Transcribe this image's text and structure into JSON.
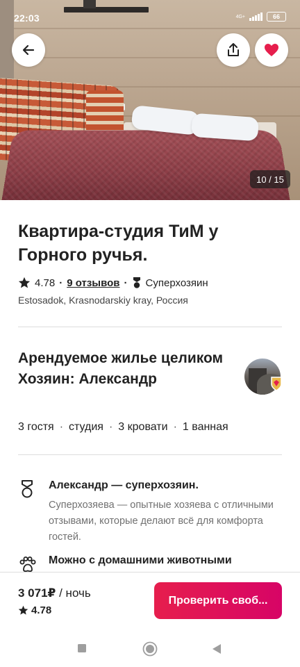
{
  "status_bar": {
    "time": "22:03",
    "network": "4G+",
    "battery": "66"
  },
  "photo": {
    "counter": "10 / 15"
  },
  "listing": {
    "title": "Квартира-студия ТиМ у Горного ручья.",
    "rating": "4.78",
    "reviews": "9 отзывов",
    "host_badge": "Суперхозяин",
    "location": "Estosadok, Krasnodarskiy kray, Россия"
  },
  "host": {
    "heading": "Арендуемое жилье целиком Хозяин: Александр"
  },
  "facts": [
    "3 гостя",
    "студия",
    "3 кровати",
    "1 ванная"
  ],
  "features": [
    {
      "title": "Александр — суперхозяин.",
      "description": "Суперхозяева — опытные хозяева с отличными отзывами, которые делают всё для комфорта гостей."
    },
    {
      "title": "Можно с домашними животными",
      "description": ""
    }
  ],
  "footer": {
    "price": "3 071₽",
    "price_unit": "/ ночь",
    "rating": "4.78",
    "cta_label": "Проверить своб..."
  },
  "colors": {
    "accent": "#E61E4D",
    "heart": "#E61E4D",
    "text": "#222222",
    "muted": "#717171"
  }
}
